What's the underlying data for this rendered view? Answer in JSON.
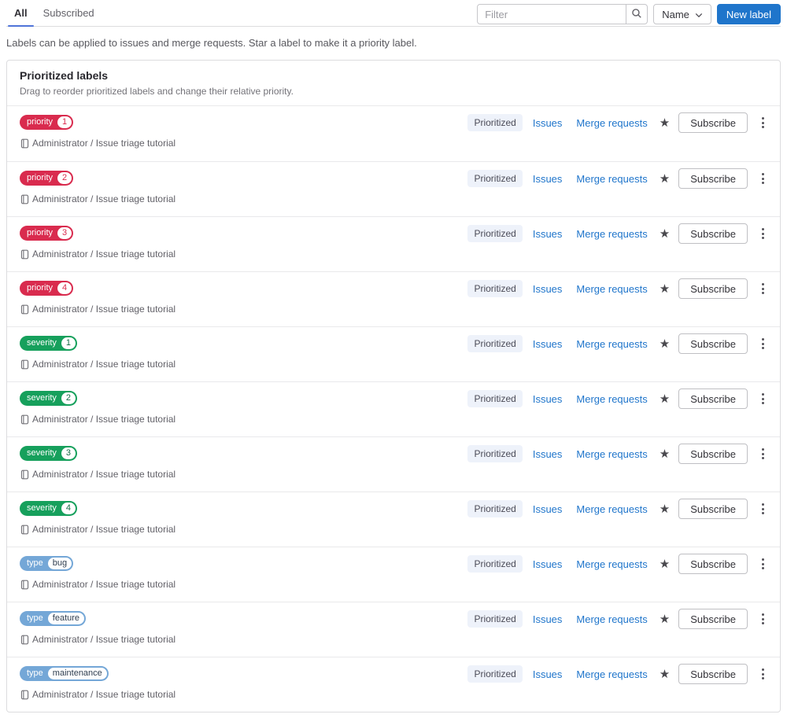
{
  "tabs": [
    {
      "label": "All",
      "active": true
    },
    {
      "label": "Subscribed",
      "active": false
    }
  ],
  "toolbar": {
    "filter_placeholder": "Filter",
    "sort_label": "Name",
    "new_label_button": "New label",
    "accent_color": "#1f75cb"
  },
  "description": "Labels can be applied to issues and merge requests. Star a label to make it a priority label.",
  "card": {
    "title": "Prioritized labels",
    "subtitle": "Drag to reorder prioritized labels and change their relative priority."
  },
  "row_shared": {
    "project": "Administrator / Issue triage tutorial",
    "prioritized_badge": "Prioritized",
    "issues_link": "Issues",
    "merge_requests_link": "Merge requests",
    "subscribe_button": "Subscribe"
  },
  "labels": [
    {
      "scope": "priority",
      "value": "1",
      "color": "#d92b4e",
      "value_color": "#d92b4e"
    },
    {
      "scope": "priority",
      "value": "2",
      "color": "#d92b4e",
      "value_color": "#d92b4e"
    },
    {
      "scope": "priority",
      "value": "3",
      "color": "#d92b4e",
      "value_color": "#d92b4e"
    },
    {
      "scope": "priority",
      "value": "4",
      "color": "#d92b4e",
      "value_color": "#d92b4e"
    },
    {
      "scope": "severity",
      "value": "1",
      "color": "#16a05c",
      "value_color": "#136b46"
    },
    {
      "scope": "severity",
      "value": "2",
      "color": "#16a05c",
      "value_color": "#136b46"
    },
    {
      "scope": "severity",
      "value": "3",
      "color": "#16a05c",
      "value_color": "#136b46"
    },
    {
      "scope": "severity",
      "value": "4",
      "color": "#16a05c",
      "value_color": "#136b46"
    },
    {
      "scope": "type",
      "value": "bug",
      "color": "#74a7d7",
      "value_color": "#2f3e50"
    },
    {
      "scope": "type",
      "value": "feature",
      "color": "#74a7d7",
      "value_color": "#2f3e50"
    },
    {
      "scope": "type",
      "value": "maintenance",
      "color": "#74a7d7",
      "value_color": "#2f3e50"
    }
  ]
}
